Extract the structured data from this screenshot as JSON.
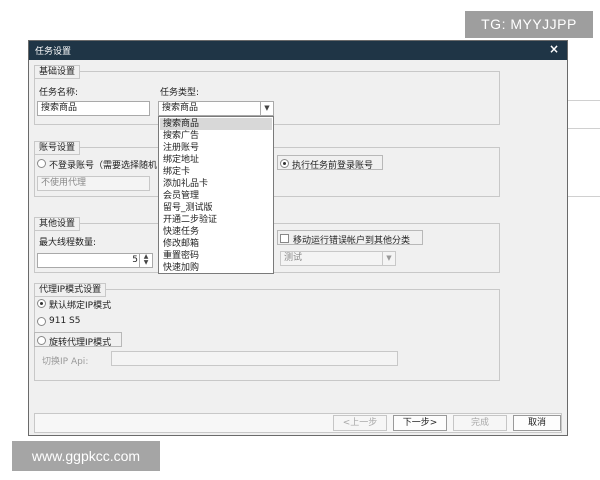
{
  "watermarks": {
    "top": "TG: MYYJJPP",
    "bottom": "www.ggpkcc.com"
  },
  "dialog": {
    "title": "任务设置",
    "close_symbol": "×"
  },
  "basic": {
    "legend": "基础设置",
    "task_name_label": "任务名称:",
    "task_type_label": "任务类型:",
    "task_name_value": "搜索商品",
    "task_type_value": "搜索商品",
    "task_type_options": [
      "搜索商品",
      "搜索广告",
      "注册账号",
      "绑定地址",
      "绑定卡",
      "添加礼品卡",
      "会员管理",
      "留号_测试版",
      "开通二步验证",
      "快速任务",
      "修改邮箱",
      "重置密码",
      "快速加购"
    ]
  },
  "account": {
    "legend": "账号设置",
    "radio_no_login": "不登录账号（需要选择随机",
    "proxy_placeholder": "不使用代理",
    "radio_login_before": "执行任务前登录账号"
  },
  "other": {
    "legend": "其他设置",
    "max_threads_label": "最大线程数量:",
    "max_threads_value": "5",
    "move_error_label": "移动运行错误帐户到其他分类",
    "category_value": "测试"
  },
  "proxy_ip": {
    "legend": "代理IP模式设置",
    "radio_default": "默认绑定IP模式",
    "radio_911": "911 S5",
    "radio_rotate": "旋转代理IP模式",
    "switch_api_label": "切换IP Api:"
  },
  "footer": {
    "prev": "<上一步",
    "next": "下一步>",
    "finish": "完成",
    "cancel": "取消"
  }
}
